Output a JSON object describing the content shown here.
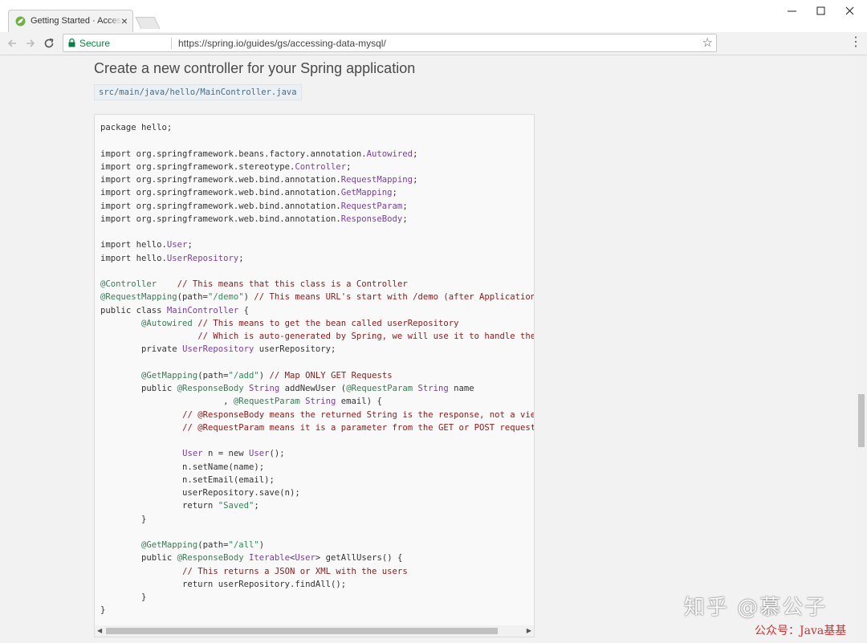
{
  "browser": {
    "tab_title": "Getting Started · Accessing Data with MySQL",
    "tab_close": "×",
    "window_minimize": "—",
    "window_maximize": "☐",
    "window_close": "✕",
    "secure_label": "Secure",
    "url": "https://spring.io/guides/gs/accessing-data-mysql/",
    "icons": [
      "back-icon",
      "forward-icon",
      "reload-icon",
      "lock-icon",
      "star-icon",
      "menu-icon"
    ]
  },
  "page": {
    "heading": "Create a new controller for your Spring application",
    "file_path": "src/main/java/hello/MainController.java",
    "code_lines": [
      "package hello;",
      "",
      "import org.springframework.beans.factory.annotation.Autowired;",
      "import org.springframework.stereotype.Controller;",
      "import org.springframework.web.bind.annotation.RequestMapping;",
      "import org.springframework.web.bind.annotation.GetMapping;",
      "import org.springframework.web.bind.annotation.RequestParam;",
      "import org.springframework.web.bind.annotation.ResponseBody;",
      "",
      "import hello.User;",
      "import hello.UserRepository;",
      "",
      "@Controller    // This means that this class is a Controller",
      "@RequestMapping(path=\"/demo\") // This means URL's start with /demo (after Application p",
      "public class MainController {",
      "        @Autowired // This means to get the bean called userRepository",
      "                   // Which is auto-generated by Spring, we will use it to handle the d",
      "        private UserRepository userRepository;",
      "",
      "        @GetMapping(path=\"/add\") // Map ONLY GET Requests",
      "        public @ResponseBody String addNewUser (@RequestParam String name",
      "                        , @RequestParam String email) {",
      "                // @ResponseBody means the returned String is the response, not a view",
      "                // @RequestParam means it is a parameter from the GET or POST request",
      "",
      "                User n = new User();",
      "                n.setName(name);",
      "                n.setEmail(email);",
      "                userRepository.save(n);",
      "                return \"Saved\";",
      "        }",
      "",
      "        @GetMapping(path=\"/all\")",
      "        public @ResponseBody Iterable<User> getAllUsers() {",
      "                // This returns a JSON or XML with the users",
      "                return userRepository.findAll();",
      "        }",
      "}"
    ]
  },
  "watermark": {
    "line1": "知乎 @慕公子",
    "line2": "公众号：Java基基"
  },
  "colors": {
    "keyword": "#333333",
    "type": "#7a3e9d",
    "annotation": "#3b7a57",
    "comment": "#8b1a1a",
    "string": "#2e8b57",
    "secure": "#0b8043"
  }
}
